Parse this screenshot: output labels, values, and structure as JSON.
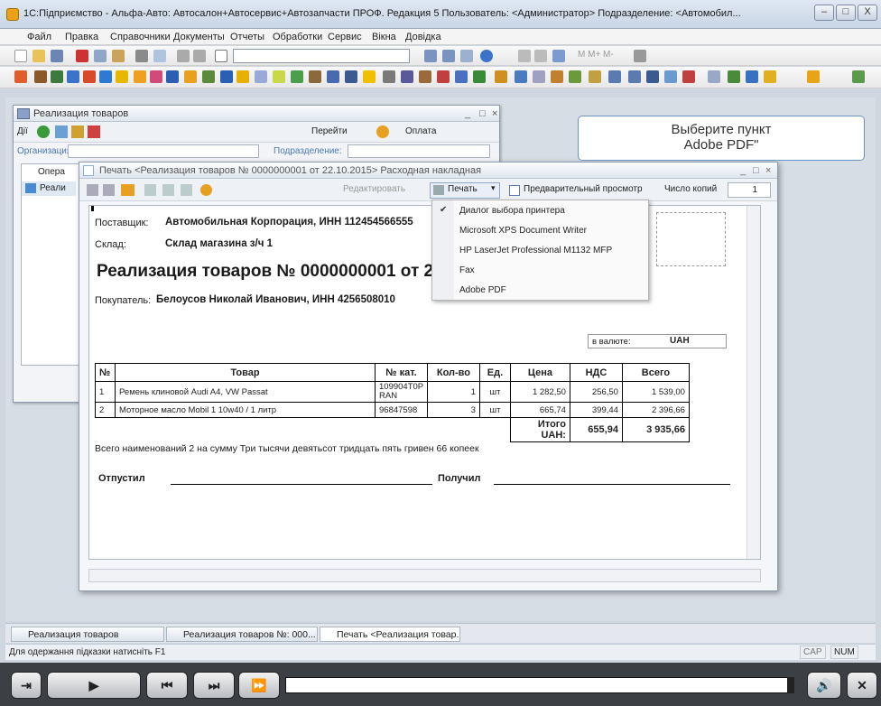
{
  "window": {
    "title": "1С:Підприємство - Альфа-Авто: Автосалон+Автосервис+Автозапчасти ПРОФ. Редакция 5   Пользователь: <Администратор>   Подразделение: <Автомобил...",
    "min": "–",
    "max": "□",
    "close": "X"
  },
  "menu": [
    "Файл",
    "Правка",
    "Справочники",
    "Документы",
    "Отчеты",
    "Обработки",
    "Сервис",
    "Вікна",
    "Довідка"
  ],
  "toolbar": {
    "mplus": "M  M+  M-"
  },
  "list_form": {
    "title": "Реализация товаров",
    "actions_label": "Дії",
    "goto_label": "Перейти",
    "pay_label": "Оплата",
    "org_label": "Организация:",
    "dept_label": "Подразделение:",
    "col_op": "Опера",
    "row_text": "Реали"
  },
  "print_form": {
    "title": "Печать <Реализация товаров № 0000000001 от 22.10.2015> Расходная накладная",
    "edit_label": "Редактировать",
    "print_label": "Печать",
    "preview_label": "Предварительный просмотр",
    "copies_label": "Число копий",
    "copies_value": "1"
  },
  "dropdown": {
    "items": [
      "Диалог выбора принтера",
      "Microsoft XPS Document Writer",
      "HP LaserJet Professional M1132 MFP",
      "Fax",
      "Adobe PDF"
    ],
    "checked": "✔"
  },
  "callout": {
    "line1": "Выберите пункт",
    "line2": "Adobe PDF\""
  },
  "document": {
    "supplier_label": "Поставщик:",
    "supplier_value": "Автомобильная Корпорация, ИНН 112454566555",
    "warehouse_label": "Склад:",
    "warehouse_value": "Склад магазина з/ч 1",
    "heading": "Реализация товаров № 0000000001 от 22",
    "buyer_label": "Покупатель:",
    "buyer_value": "Белоусов Николай Иванович, ИНН 4256508010",
    "currency_label": "в валюте:",
    "currency_value": "UAH",
    "headers": [
      "№",
      "Товар",
      "№ кат.",
      "Кол-во",
      "Ед.",
      "Цена",
      "НДС",
      "Всего"
    ],
    "rows": [
      [
        "1",
        "Ремень клиновой Audi A4, VW Passat",
        "109904T0P RAN",
        "1",
        "шт",
        "1 282,50",
        "256,50",
        "1 539,00"
      ],
      [
        "2",
        "Моторное масло Mobil 1 10w40 / 1 литр",
        "96847598",
        "3",
        "шт",
        "665,74",
        "399,44",
        "2 396,66"
      ]
    ],
    "total_label": "Итого UAH:",
    "total_vat": "655,94",
    "total_sum": "3 935,66",
    "sum_words": "Всего наименований 2 на сумму Три тысячи девятьсот тридцать пять гривен 66 копеек",
    "released_label": "Отпустил",
    "received_label": "Получил"
  },
  "taskbar": [
    "Реализация товаров",
    "Реализация товаров №: 000...",
    "Печать <Реализация товар..."
  ],
  "status": {
    "hint": "Для одержання підказки натисніть F1",
    "cap": "CAP",
    "num": "NUM"
  },
  "colors": {
    "accent": "#6a96c6",
    "titlebar": "#c9d6e6"
  }
}
